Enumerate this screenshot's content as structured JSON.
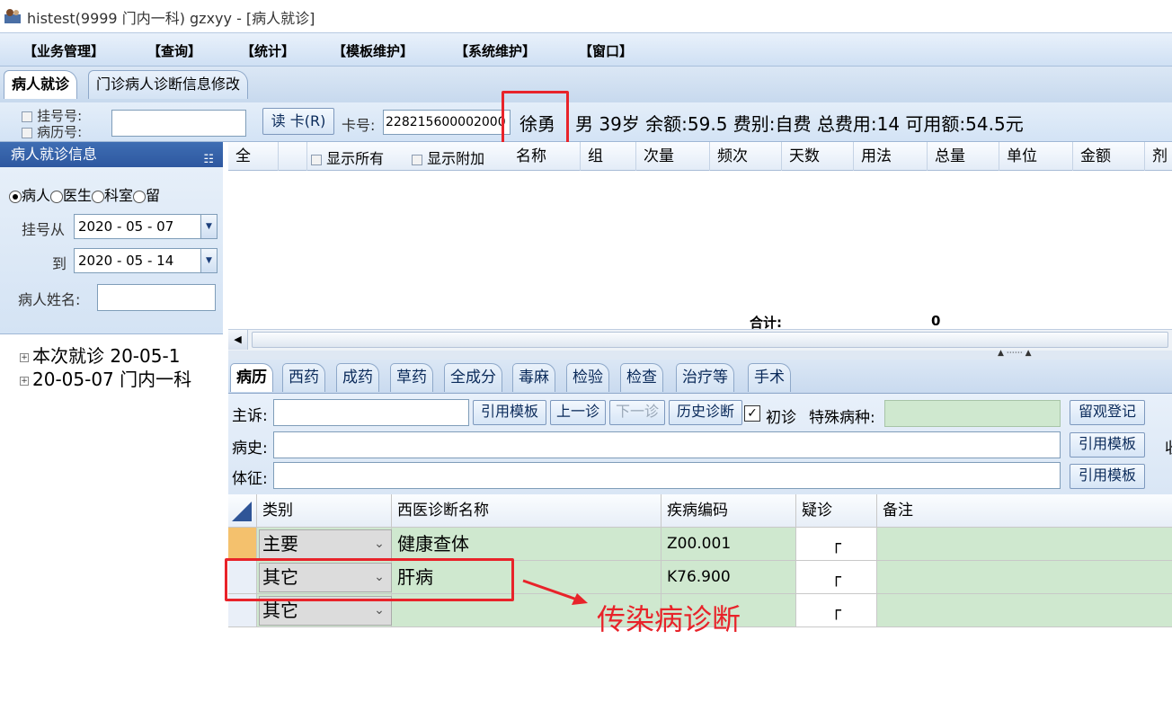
{
  "window": {
    "title": "histest(9999 门内一科) gzxyy - [病人就诊]"
  },
  "menu": [
    "【业务管理】",
    "【查询】",
    "【统计】",
    "【模板维护】",
    "【系统维护】",
    "【窗口】"
  ],
  "doc_tabs": [
    "病人就诊",
    "门诊病人诊断信息修改"
  ],
  "patient_bar": {
    "reg_no_label": "挂号号:",
    "record_no_label": "病历号:",
    "read_card_button": "读 卡(R)",
    "card_label": "卡号:",
    "card_value": "228215600002000",
    "name": "徐勇",
    "summary": "男  39岁  余额:59.5  费别:自费  总费用:14  可用额:54.5元"
  },
  "left_panel": {
    "title": "病人就诊信息",
    "radios": [
      {
        "label": "病人",
        "checked": true
      },
      {
        "label": "医生",
        "checked": false
      },
      {
        "label": "科室",
        "checked": false
      },
      {
        "label": "留",
        "checked": false
      }
    ],
    "reg_from_label": "挂号从",
    "reg_from_value": "2020 - 05 - 07",
    "reg_to_label": "到",
    "reg_to_value": "2020 - 05 - 14",
    "patient_name_label": "病人姓名:",
    "tree": [
      "本次就诊  20-05-1",
      "20-05-07 门内一科"
    ]
  },
  "prescription": {
    "columns": [
      "全",
      "",
      "",
      "",
      "名称",
      "组",
      "次量",
      "频次",
      "天数",
      "用法",
      "总量",
      "单位",
      "金额",
      "剂"
    ],
    "show_all": "显示所有",
    "show_extra": "显示附加",
    "total_label": "合计:",
    "total_value": "0"
  },
  "sub_tabs": [
    "病历",
    "西药",
    "成药",
    "草药",
    "全成分",
    "毒麻",
    "检验",
    "检查",
    "治疗等",
    "手术"
  ],
  "emr": {
    "complaint_label": "主诉:",
    "history_label": "病史:",
    "signs_label": "体征:",
    "cite_template": "引用模板",
    "prev_visit": "上一诊",
    "next_visit": "下一诊",
    "history_diag": "历史诊断",
    "first_visit_label": "初诊",
    "special_disease_label": "特殊病种:",
    "observe_register": "留观登记",
    "side_char": "收"
  },
  "diagnosis": {
    "headers": [
      "类别",
      "西医诊断名称",
      "疾病编码",
      "疑诊",
      "备注"
    ],
    "rows": [
      {
        "category": "主要",
        "name": "健康查体",
        "code": "Z00.001",
        "suspect": "┌"
      },
      {
        "category": "其它",
        "name": "肝病",
        "code": "K76.900",
        "suspect": "┌"
      },
      {
        "category": "其它",
        "name": "",
        "code": "",
        "suspect": "┌"
      }
    ]
  },
  "annotation": {
    "text": "传染病诊断",
    "color": "#e8232a"
  },
  "colors": {
    "accent_header": "#2e58a0",
    "row_green": "#cfe8cf",
    "highlight_red": "#e8232a"
  }
}
